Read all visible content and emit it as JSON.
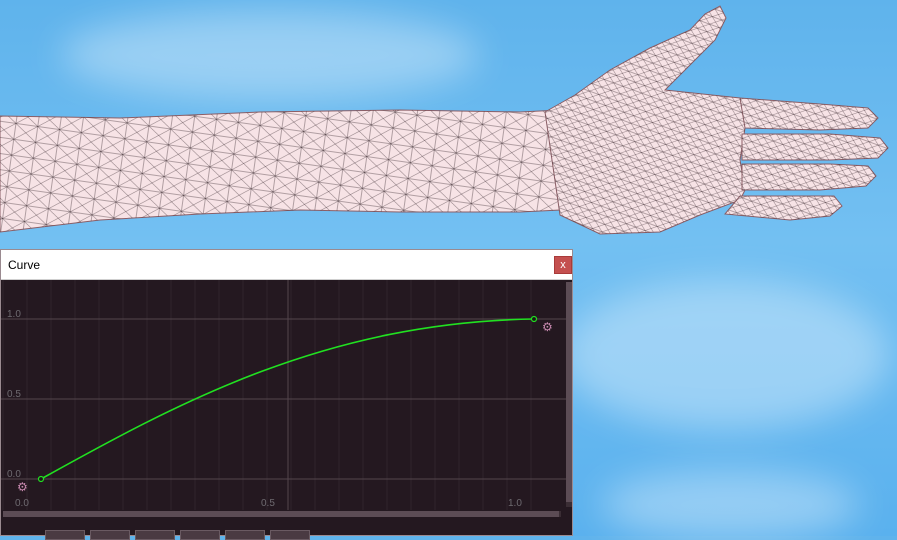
{
  "viewport": {
    "background": "sky",
    "model": "arm-mesh-wireframe",
    "mesh_color": "#f7e3e6",
    "wire_color": "#3a2a30"
  },
  "curve_window": {
    "title": "Curve",
    "close_label": "x",
    "y_tick_labels": [
      "1.0",
      "0.5",
      "0.0"
    ],
    "x_tick_labels": [
      "0.0",
      "0.5",
      "1.0"
    ],
    "curve_color": "#21e021",
    "grid_color": "#4a3a42",
    "key_icon": "gear-icon",
    "preset_buttons": [
      "preset-linear",
      "preset-ease-in",
      "preset-ease-out",
      "preset-ease-in-out",
      "preset-custom",
      "preset-extra"
    ]
  }
}
